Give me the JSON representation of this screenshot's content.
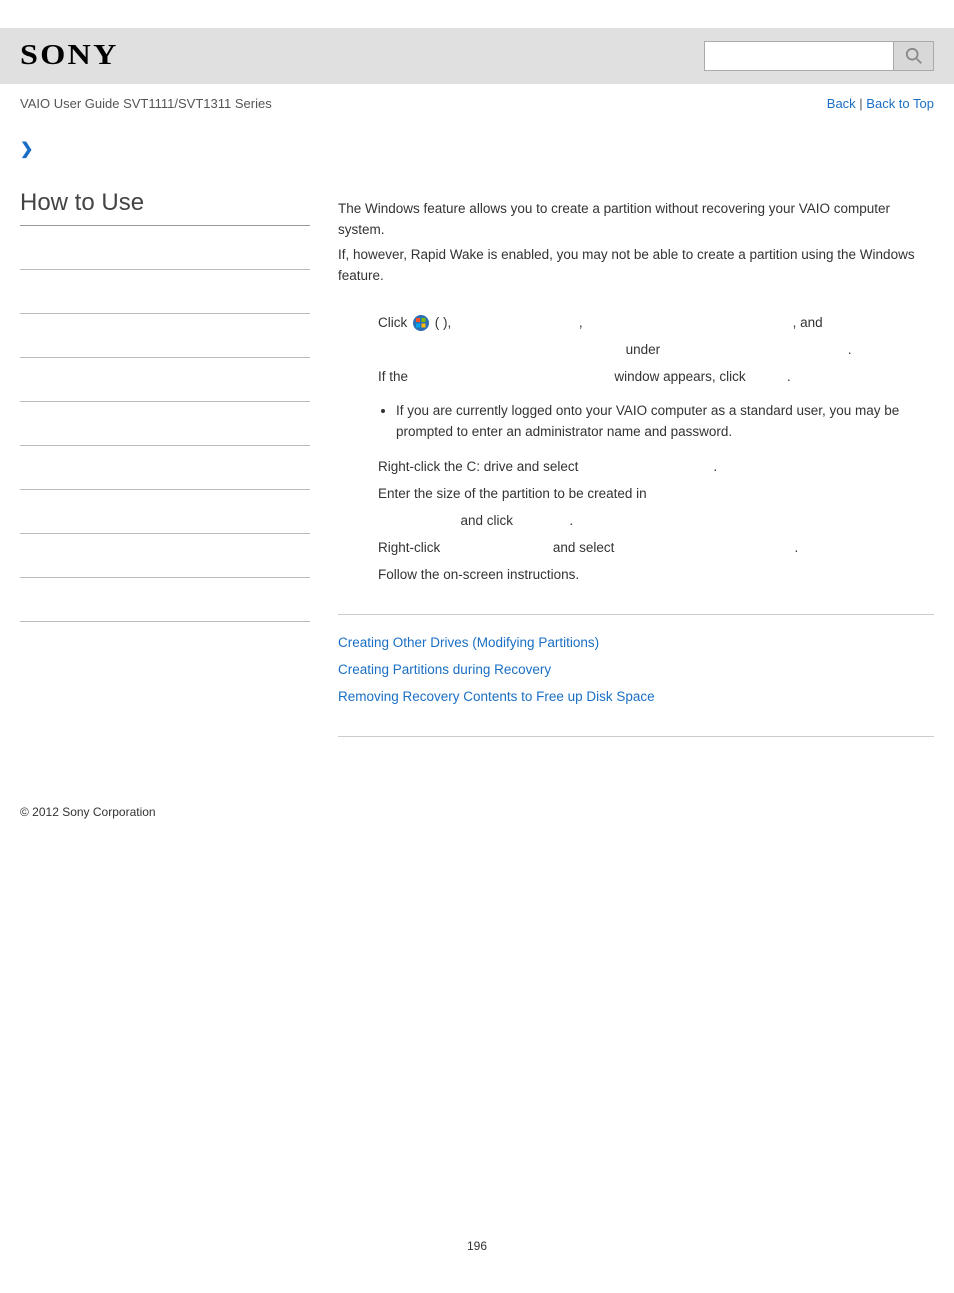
{
  "header": {
    "logo": "SONY",
    "search_placeholder": ""
  },
  "subheader": {
    "guide_title": "VAIO User Guide SVT1111/SVT1311 Series",
    "back": "Back",
    "back_to_top": "Back to Top",
    "sep": " | "
  },
  "sidebar": {
    "title": "How to Use"
  },
  "main": {
    "intro1": "The Windows feature allows you to create a partition without recovering your VAIO computer system.",
    "intro2": "If, however, Rapid Wake is enabled, you may not be able to create a partition using the Windows feature.",
    "step1_a": "Click ",
    "step1_b": " (          ), ",
    "step1_c": ", ",
    "step1_d": ", and",
    "step1_line2_a": "under",
    "step1_line2_b": ".",
    "step1_line3_a": "If the",
    "step1_line3_b": "window appears, click",
    "step1_line3_c": ".",
    "bullet1": "If you are currently logged onto your VAIO computer as a standard user, you may be prompted to enter an administrator name and password.",
    "step2_a": "Right-click the C: drive and select",
    "step2_b": ".",
    "step3_a": "Enter the size of the partition to be created in",
    "step3_b": "and click",
    "step3_c": ".",
    "step4_a": "Right-click",
    "step4_b": "and select",
    "step4_c": ".",
    "step5": "Follow the on-screen instructions."
  },
  "related": {
    "link1": "Creating Other Drives (Modifying Partitions)",
    "link2": "Creating Partitions during Recovery",
    "link3": "Removing Recovery Contents to Free up Disk Space"
  },
  "footer": {
    "copyright": "© 2012 Sony Corporation",
    "page_num": "196"
  }
}
